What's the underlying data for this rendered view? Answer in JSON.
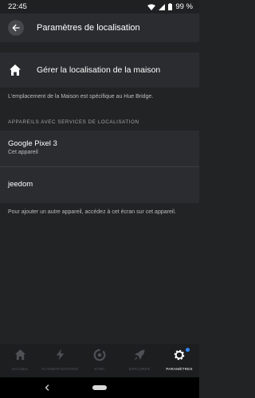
{
  "status_bar": {
    "time": "22:45",
    "battery": "99 %"
  },
  "toolbar": {
    "title": "Paramètres de localisation",
    "back_icon": "arrow-left-icon"
  },
  "home_row": {
    "label": "Gérer la localisation de la maison",
    "icon": "home-icon"
  },
  "home_note": "L'emplacement de la Maison est spécifique au Hue Bridge.",
  "devices_section": {
    "header": "APPAREILS AVEC SERVICES DE LOCALISATION",
    "devices": [
      {
        "name": "Google Pixel 3",
        "subtitle": "Cet appareil"
      },
      {
        "name": "jeedom"
      }
    ]
  },
  "add_device_note": "Pour ajouter un autre appareil, accédez à cet écran sur cet appareil.",
  "bottom_nav": [
    {
      "label": "ACCUEIL",
      "icon": "home-icon",
      "active": false
    },
    {
      "label": "AUTOMATISATIONS",
      "icon": "lightning-icon",
      "active": false
    },
    {
      "label": "SYNC",
      "icon": "sync-icon",
      "active": false
    },
    {
      "label": "EXPLORER",
      "icon": "rocket-icon",
      "active": false
    },
    {
      "label": "PARAMÈTRES",
      "icon": "gear-icon",
      "active": true
    }
  ],
  "colors": {
    "accent": "#2f8bff",
    "background": "#212325",
    "surface": "#2a2c2f"
  }
}
